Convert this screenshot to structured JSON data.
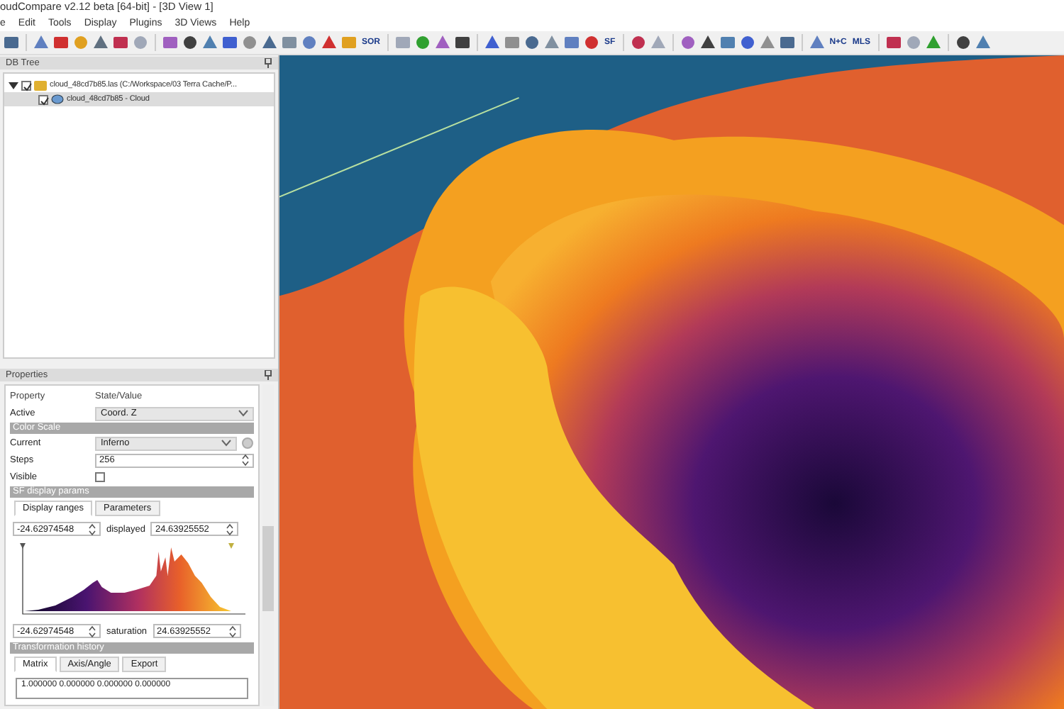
{
  "window": {
    "title": "oudCompare v2.12 beta [64-bit] - [3D View 1]"
  },
  "menu": [
    "e",
    "Edit",
    "Tools",
    "Display",
    "Plugins",
    "3D Views",
    "Help"
  ],
  "toolbar": [
    {
      "kind": "icon"
    },
    {
      "kind": "sep"
    },
    {
      "kind": "icon"
    },
    {
      "kind": "icon"
    },
    {
      "kind": "icon"
    },
    {
      "kind": "icon"
    },
    {
      "kind": "icon"
    },
    {
      "kind": "icon"
    },
    {
      "kind": "sep"
    },
    {
      "kind": "icon"
    },
    {
      "kind": "icon"
    },
    {
      "kind": "icon"
    },
    {
      "kind": "icon"
    },
    {
      "kind": "icon"
    },
    {
      "kind": "icon"
    },
    {
      "kind": "icon"
    },
    {
      "kind": "icon"
    },
    {
      "kind": "icon"
    },
    {
      "kind": "icon"
    },
    {
      "kind": "label",
      "label": "SOR"
    },
    {
      "kind": "sep"
    },
    {
      "kind": "icon"
    },
    {
      "kind": "icon"
    },
    {
      "kind": "icon"
    },
    {
      "kind": "icon"
    },
    {
      "kind": "sep"
    },
    {
      "kind": "icon"
    },
    {
      "kind": "icon"
    },
    {
      "kind": "icon"
    },
    {
      "kind": "icon"
    },
    {
      "kind": "icon"
    },
    {
      "kind": "icon"
    },
    {
      "kind": "label",
      "label": "SF"
    },
    {
      "kind": "sep"
    },
    {
      "kind": "icon"
    },
    {
      "kind": "icon"
    },
    {
      "kind": "sep"
    },
    {
      "kind": "icon"
    },
    {
      "kind": "icon"
    },
    {
      "kind": "icon"
    },
    {
      "kind": "icon"
    },
    {
      "kind": "icon"
    },
    {
      "kind": "icon"
    },
    {
      "kind": "sep"
    },
    {
      "kind": "icon"
    },
    {
      "kind": "label",
      "label": "N+C"
    },
    {
      "kind": "label",
      "label": "MLS"
    },
    {
      "kind": "sep"
    },
    {
      "kind": "icon"
    },
    {
      "kind": "icon"
    },
    {
      "kind": "icon"
    },
    {
      "kind": "sep"
    },
    {
      "kind": "icon"
    },
    {
      "kind": "icon"
    }
  ],
  "db_tree": {
    "title": "DB Tree",
    "items": [
      {
        "label": "cloud_48cd7b85.las (C:/Workspace/03 Terra Cache/P...",
        "checked": true,
        "expanded": true,
        "selected": false,
        "children": [
          {
            "label": "cloud_48cd7b85 - Cloud",
            "checked": true,
            "selected": true
          }
        ]
      }
    ]
  },
  "properties": {
    "title": "Properties",
    "header": [
      "Property",
      "State/Value"
    ],
    "active": {
      "label": "Active",
      "value": "Coord. Z"
    },
    "color_scale_section": "Color Scale",
    "current": {
      "label": "Current",
      "value": "Inferno"
    },
    "steps": {
      "label": "Steps",
      "value": "256"
    },
    "visible": {
      "label": "Visible",
      "checked": false
    },
    "sf_section": "SF display params",
    "sf_tabs": [
      {
        "label": "Display ranges",
        "selected": true
      },
      {
        "label": "Parameters",
        "selected": false
      }
    ],
    "displayed": {
      "min": "-24.62974548",
      "label": "displayed",
      "max": "24.63925552"
    },
    "saturation": {
      "min": "-24.62974548",
      "label": "saturation",
      "max": "24.63925552"
    },
    "transform_section": "Transformation history",
    "transform_tabs": [
      {
        "label": "Matrix",
        "selected": true
      },
      {
        "label": "Axis/Angle",
        "selected": false
      },
      {
        "label": "Export",
        "selected": false
      }
    ],
    "matrix_row": "1.000000 0.000000 0.000000 0.000000"
  }
}
